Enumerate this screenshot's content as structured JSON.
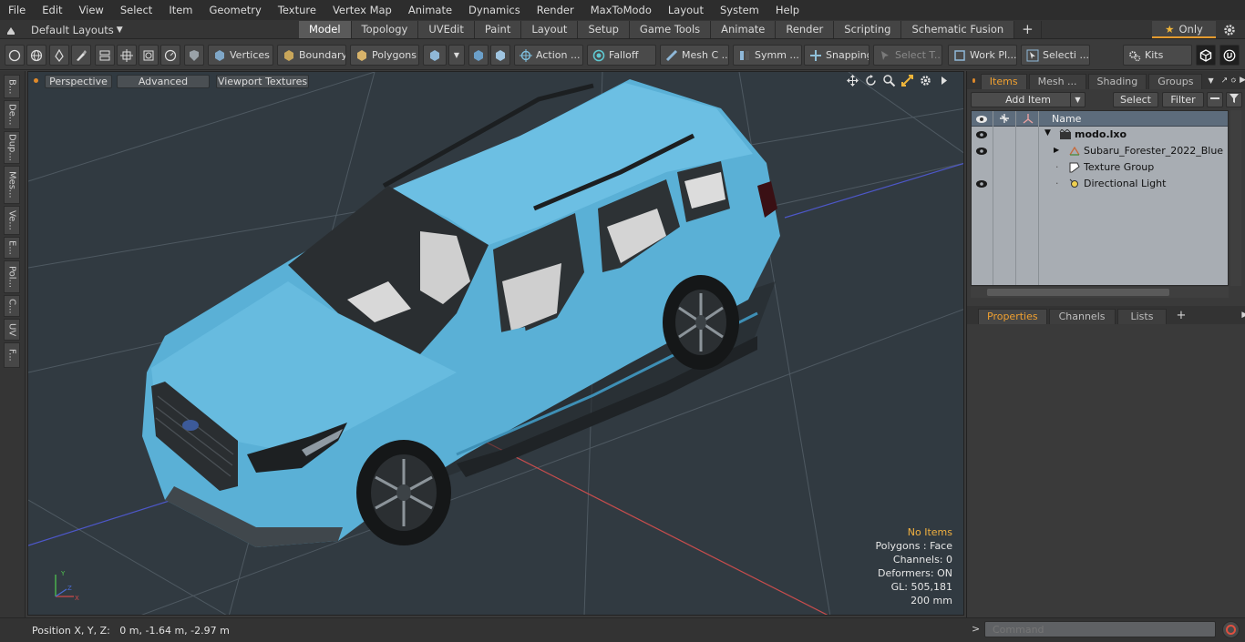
{
  "menubar": {
    "items": [
      "File",
      "Edit",
      "View",
      "Select",
      "Item",
      "Geometry",
      "Texture",
      "Vertex Map",
      "Animate",
      "Dynamics",
      "Render",
      "MaxToModo",
      "Layout",
      "System",
      "Help"
    ]
  },
  "layoutbar": {
    "layout_selector": "Default Layouts",
    "tabs": [
      "Model",
      "Topology",
      "UVEdit",
      "Paint",
      "Layout",
      "Setup",
      "Game Tools",
      "Animate",
      "Render",
      "Scripting",
      "Schematic Fusion"
    ],
    "active_tab": "Model",
    "only_label": "Only"
  },
  "toolbar": {
    "vertices": "Vertices",
    "boundary": "Boundary",
    "polygons": "Polygons",
    "action": "Action ...",
    "falloff": "Falloff",
    "mesh": "Mesh C ...",
    "symmetry": "Symm ...",
    "snapping": "Snapping",
    "select_t": "Select T...",
    "work_plane": "Work Pl...",
    "selection": "Selecti ...",
    "kits": "Kits"
  },
  "leftstrip": {
    "tabs": [
      "B...",
      "De...",
      "Dup...",
      "Mes...",
      "Ve...",
      "E...",
      "Pol...",
      "C...",
      "UV",
      "F..."
    ]
  },
  "viewport": {
    "perspective": "Perspective",
    "advanced": "Advanced",
    "viewport_textures": "Viewport Textures",
    "info": {
      "no_items": "No Items",
      "polygons": "Polygons : Face",
      "channels": "Channels: 0",
      "deformers": "Deformers: ON",
      "gl": "GL: 505,181",
      "grid": "200 mm"
    }
  },
  "statusbar": {
    "position": "Position X, Y, Z:   0 m, -1.64 m, -2.97 m"
  },
  "itemspanel": {
    "tabs": [
      "Items",
      "Mesh ...",
      "Shading",
      "Groups"
    ],
    "active_tab": "Items",
    "add_item": "Add Item",
    "select": "Select",
    "filter": "Filter",
    "column_name": "Name",
    "rows": [
      {
        "label": "modo.lxo"
      },
      {
        "label": "Subaru_Forester_2022_Blue"
      },
      {
        "label": "Texture Group"
      },
      {
        "label": "Directional Light"
      }
    ]
  },
  "propspanel": {
    "tabs": [
      "Properties",
      "Channels",
      "Lists"
    ],
    "active_tab": "Properties"
  },
  "commandbar": {
    "placeholder": "Command"
  },
  "colors": {
    "accent": "#e39a2e",
    "car_body": "#5ab0d6",
    "viewport_bg": "#313a41"
  }
}
